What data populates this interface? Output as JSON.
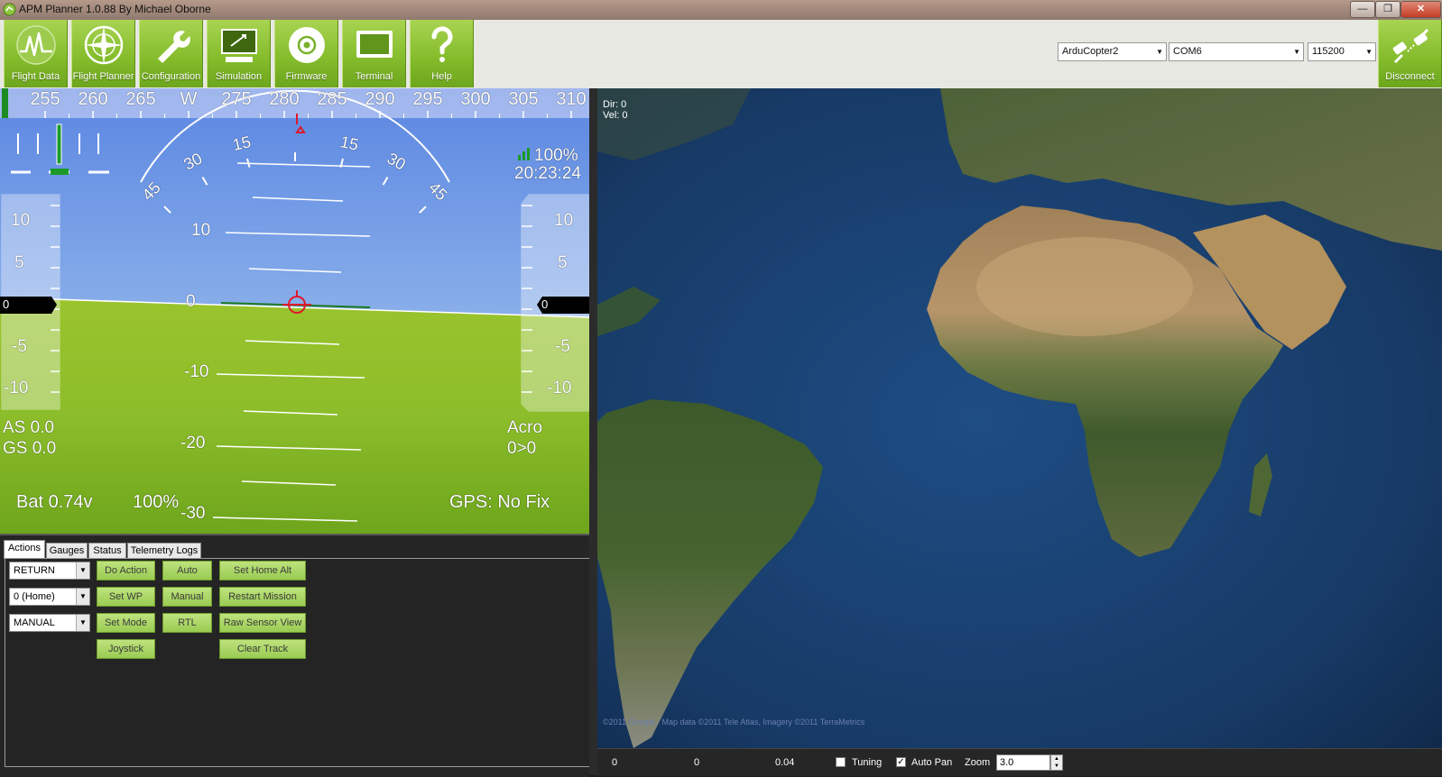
{
  "window": {
    "title": "APM Planner 1.0.88  By Michael Oborne",
    "controls": [
      "minimize",
      "maximize",
      "close"
    ]
  },
  "toolbar": {
    "buttons": [
      {
        "label": "Flight Data",
        "icon": "waveform-icon"
      },
      {
        "label": "Flight Planner",
        "icon": "compass-icon"
      },
      {
        "label": "Configuration",
        "icon": "wrench-icon"
      },
      {
        "label": "Simulation",
        "icon": "simulator-screen-icon"
      },
      {
        "label": "Firmware",
        "icon": "disc-icon"
      },
      {
        "label": "Terminal",
        "icon": "monitor-icon"
      },
      {
        "label": "Help",
        "icon": "question-mark-icon"
      }
    ],
    "vehicle_select": "ArduCopter2",
    "port_select": "COM6",
    "baud_select": "115200",
    "disconnect_label": "Disconnect"
  },
  "hud": {
    "heading_ticks": [
      "255",
      "260",
      "265",
      "W",
      "275",
      "280",
      "285",
      "290",
      "295",
      "300",
      "305",
      "310"
    ],
    "roll_labels_left": [
      "15",
      "30",
      "45"
    ],
    "roll_labels_right": [
      "15",
      "30",
      "45"
    ],
    "pitch_labels": [
      "10",
      "0",
      "-10",
      "-20",
      "-30"
    ],
    "left_tape_labels": [
      "10",
      "5",
      "-5",
      "-10"
    ],
    "right_tape_labels": [
      "10",
      "5",
      "-5",
      "-10"
    ],
    "left_tape_value": "0",
    "right_tape_value": "0",
    "link_quality": "100%",
    "clock": "20:23:24",
    "airspeed": "AS 0.0",
    "groundspeed": "GS 0.0",
    "mode": "Acro",
    "wp_status": "0>0",
    "battery": "Bat  0.74v",
    "battery_pct": "100%",
    "gps": "GPS: No Fix",
    "sky_color": "#6f98e6",
    "ground_color": "#7eb525"
  },
  "panel": {
    "tabs": [
      "Actions",
      "Gauges",
      "Status",
      "Telemetry Logs"
    ],
    "active_tab": "Actions",
    "combos": [
      "RETURN",
      "0 (Home)",
      "MANUAL"
    ],
    "buttons": {
      "do_action": "Do Action",
      "auto": "Auto",
      "set_home_alt": "Set Home Alt",
      "set_wp": "Set WP",
      "manual": "Manual",
      "restart_mission": "Restart Mission",
      "set_mode": "Set Mode",
      "rtl": "RTL",
      "raw_sensor_view": "Raw Sensor View",
      "joystick": "Joystick",
      "clear_track": "Clear Track"
    }
  },
  "map": {
    "dir": "Dir: 0",
    "vel": "Vel: 0",
    "copyright": "©2011 Google - Map data ©2011 Tele Atlas, Imagery ©2011 TerraMetrics"
  },
  "statusbar": {
    "val1": "0",
    "val2": "0",
    "val3": "0.04",
    "tuning_label": "Tuning",
    "tuning_checked": false,
    "autopan_label": "Auto Pan",
    "autopan_checked": true,
    "zoom_label": "Zoom",
    "zoom_value": "3.0"
  }
}
